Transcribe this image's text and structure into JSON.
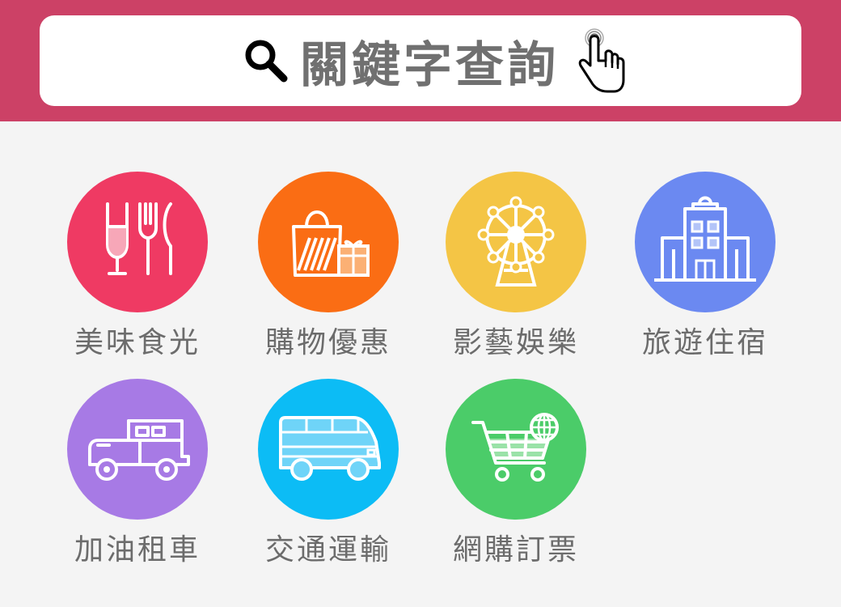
{
  "colors": {
    "header_bg": "#cc4166",
    "page_bg": "#f4f4f4",
    "label_text": "#6c6c6c",
    "search_text": "#707070"
  },
  "search": {
    "label": "關鍵字查詢",
    "icon": "search-icon",
    "cursor_icon": "hand-pointer-icon"
  },
  "categories": [
    {
      "label": "美味食光",
      "icon": "dining-icon",
      "color": "#ef3a63"
    },
    {
      "label": "購物優惠",
      "icon": "shopping-bag-icon",
      "color": "#fa6d14"
    },
    {
      "label": "影藝娛樂",
      "icon": "ferris-wheel-icon",
      "color": "#f4c545"
    },
    {
      "label": "旅遊住宿",
      "icon": "hotel-icon",
      "color": "#6b89f1"
    },
    {
      "label": "加油租車",
      "icon": "vintage-car-icon",
      "color": "#a77ae5"
    },
    {
      "label": "交通運輸",
      "icon": "bus-icon",
      "color": "#0cbcf5"
    },
    {
      "label": "網購訂票",
      "icon": "online-cart-icon",
      "color": "#4bcc69"
    }
  ]
}
